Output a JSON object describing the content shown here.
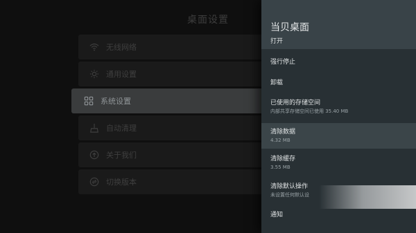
{
  "background": {
    "title": "桌面设置",
    "menu": [
      {
        "label": "无线网络",
        "icon": "wifi-icon"
      },
      {
        "label": "通用设置",
        "icon": "gear-icon"
      },
      {
        "label": "系统设置",
        "icon": "grid-icon",
        "active": true
      },
      {
        "label": "自动清理",
        "icon": "broom-icon"
      },
      {
        "label": "关于我们",
        "icon": "upload-circle-icon"
      },
      {
        "label": "切换版本",
        "icon": "switch-circle-icon"
      }
    ]
  },
  "panel": {
    "title": "当贝桌面",
    "items": [
      {
        "label": "打开",
        "sub": ""
      },
      {
        "label": "强行停止",
        "sub": ""
      },
      {
        "label": "卸载",
        "sub": ""
      },
      {
        "label": "已使用的存储空间",
        "sub": "内部共享存储空间已使用 35.40 MB"
      },
      {
        "label": "清除数据",
        "sub": "4.32 MB",
        "highlighted": true
      },
      {
        "label": "清除缓存",
        "sub": "3.55 MB"
      },
      {
        "label": "清除默认操作",
        "sub": "未设置任何默认设"
      },
      {
        "label": "通知",
        "sub": ""
      }
    ]
  },
  "colors": {
    "panel": "#283034",
    "panel_header": "#394348",
    "highlight": "#3b4549",
    "active_menu": "#3a3c3d"
  }
}
